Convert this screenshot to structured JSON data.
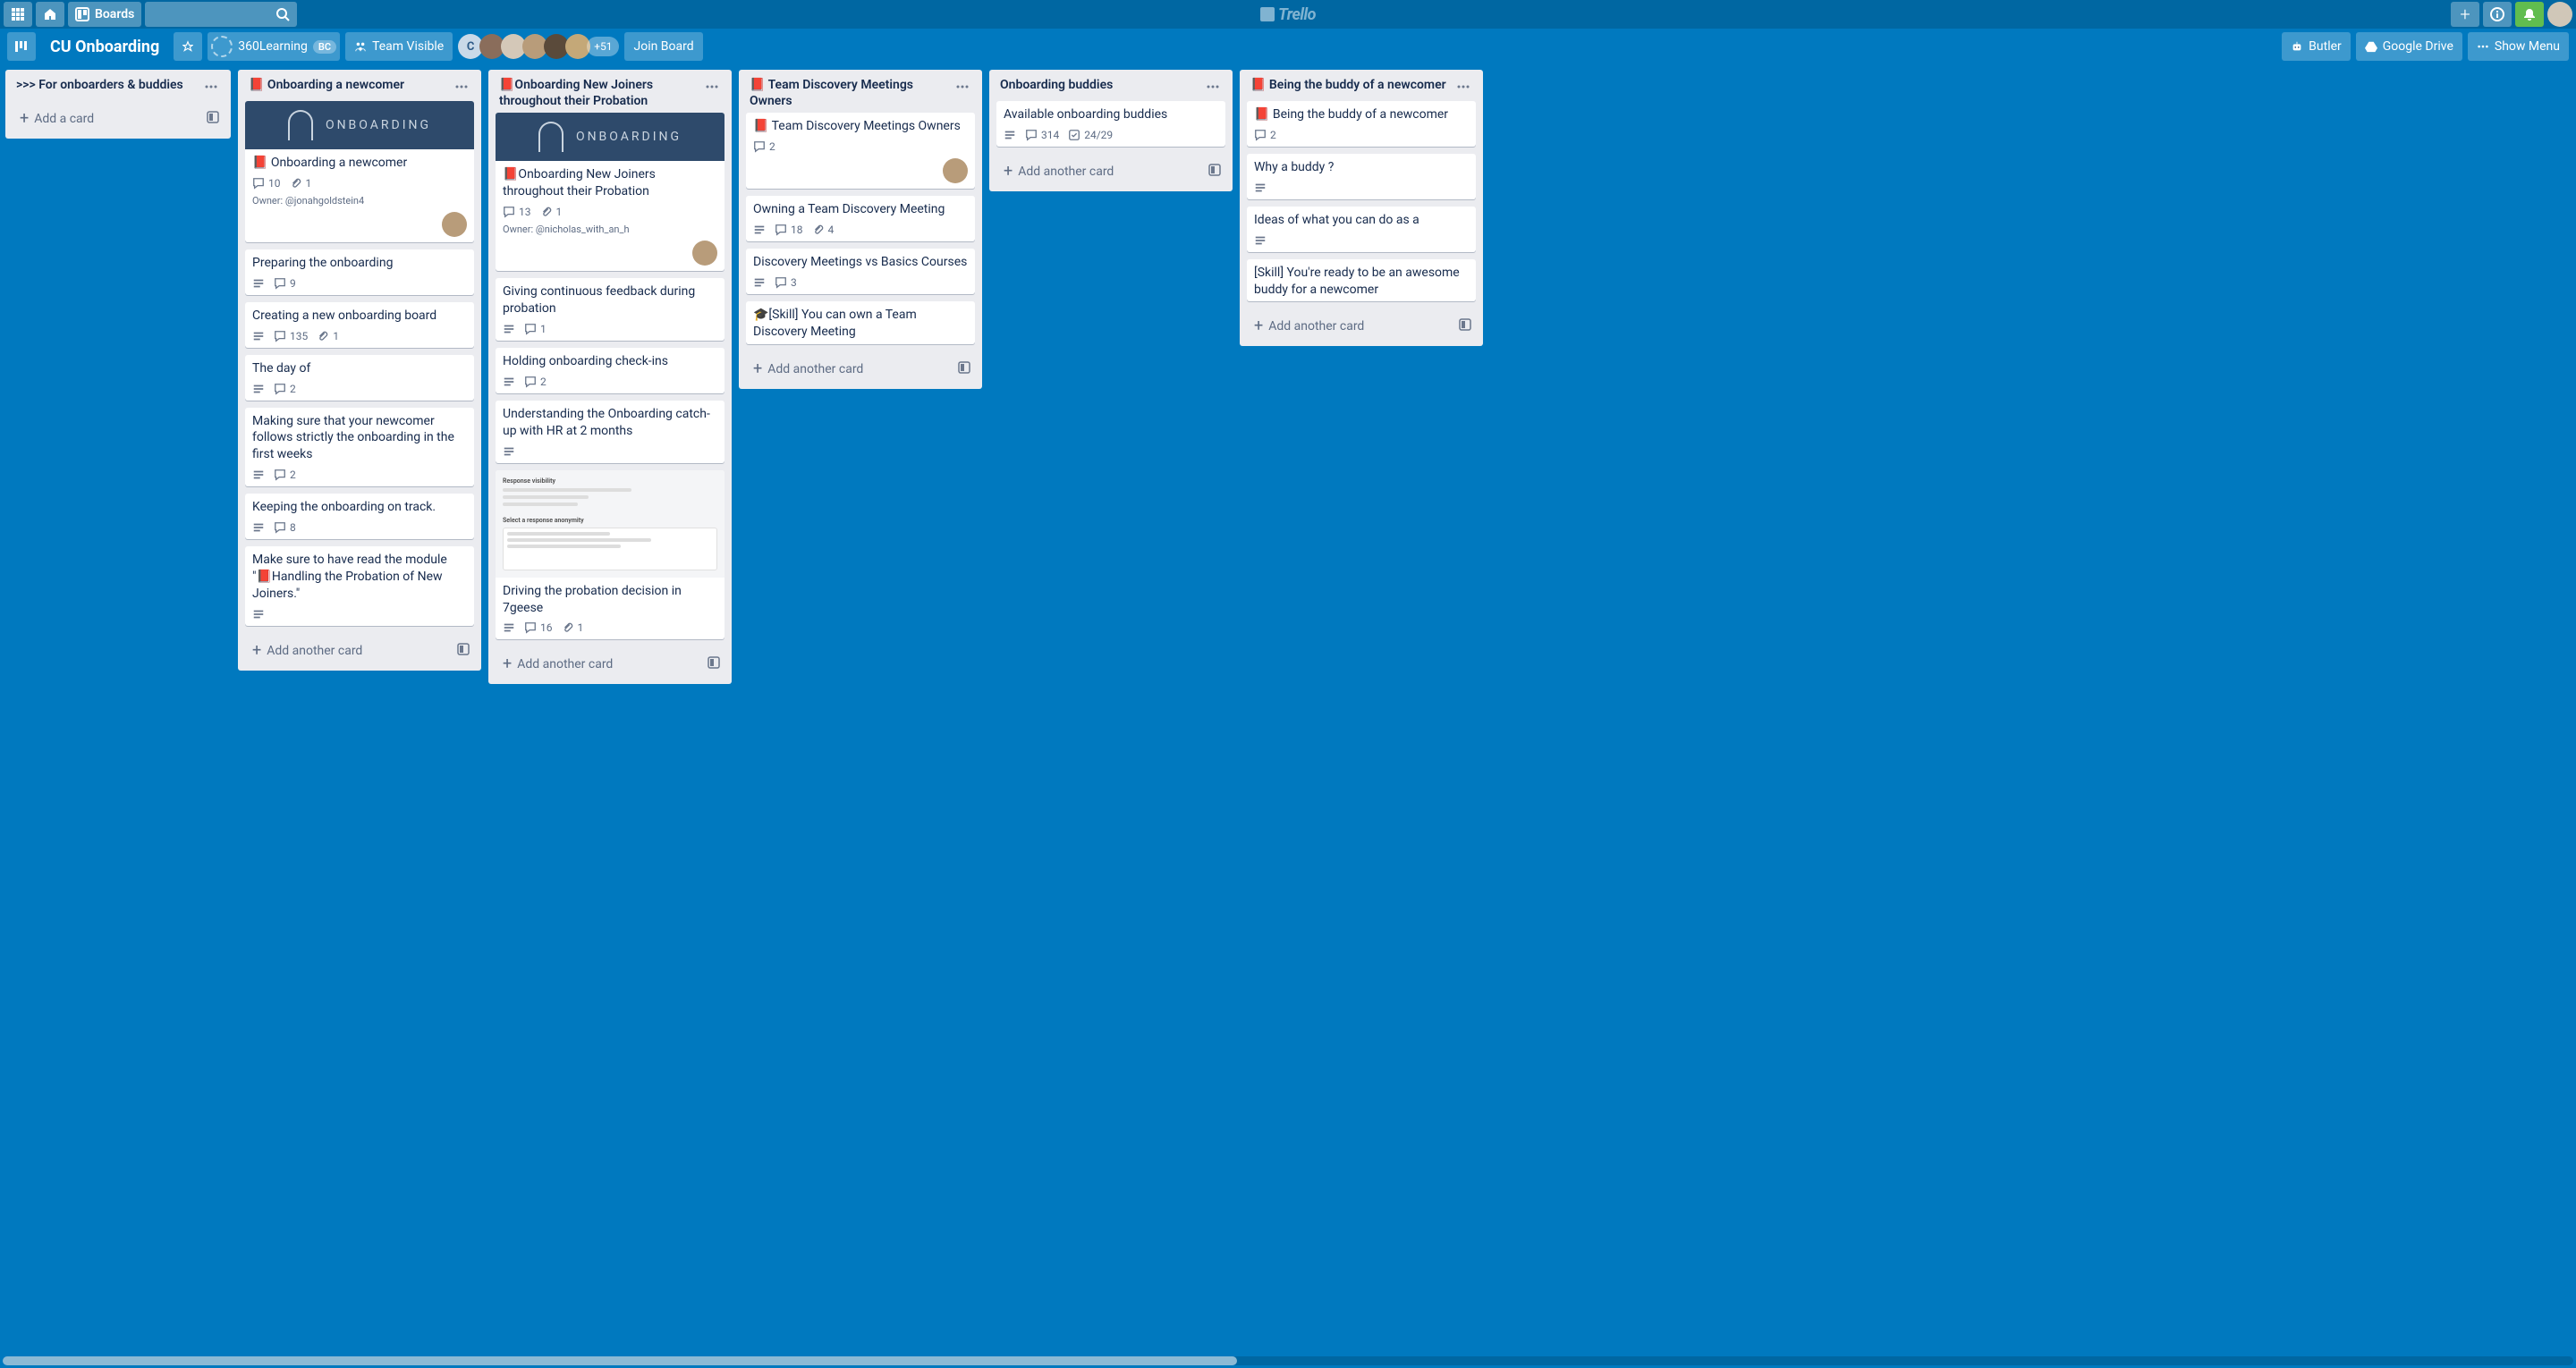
{
  "header": {
    "boards_label": "Boards",
    "logo_text": "Trello"
  },
  "board": {
    "name": "CU Onboarding",
    "org_name": "360Learning",
    "org_badge": "BC",
    "visibility": "Team Visible",
    "member_more": "+51",
    "join_label": "Join Board",
    "butler_label": "Butler",
    "gdrive_label": "Google Drive",
    "show_menu_label": "Show Menu"
  },
  "lists": [
    {
      "title": ">>> For onboarders & buddies",
      "narrow": true,
      "add_label": "Add a card",
      "cards": []
    },
    {
      "title": "📕 Onboarding a newcomer",
      "add_label": "Add another card",
      "cards": [
        {
          "cover": "ONBOARDING",
          "title": "📕 Onboarding a newcomer",
          "comments": "10",
          "attachments": "1",
          "owner": "Owner: @jonahgoldstein4",
          "avatar": true
        },
        {
          "title": "Preparing the onboarding",
          "desc": true,
          "comments": "9"
        },
        {
          "title": "Creating a new onboarding board",
          "desc": true,
          "comments": "135",
          "attachments": "1"
        },
        {
          "title": "The day of",
          "desc": true,
          "comments": "2"
        },
        {
          "title": "Making sure that your newcomer follows strictly the onboarding in the first weeks",
          "desc": true,
          "comments": "2"
        },
        {
          "title": "Keeping the onboarding on track.",
          "desc": true,
          "comments": "8"
        },
        {
          "title": "Make sure to have read the module \"📕Handling the Probation of New Joiners.\"",
          "desc": true
        }
      ]
    },
    {
      "title": "📕Onboarding New Joiners throughout their Probation",
      "add_label": "Add another card",
      "cards": [
        {
          "cover": "ONBOARDING",
          "title": "📕Onboarding New Joiners throughout their Probation",
          "comments": "13",
          "attachments": "1",
          "owner": "Owner: @nicholas_with_an_h",
          "avatar": true
        },
        {
          "title": "Giving continuous feedback during probation",
          "desc": true,
          "comments": "1"
        },
        {
          "title": "Holding onboarding check-ins",
          "desc": true,
          "comments": "2"
        },
        {
          "title": "Understanding the Onboarding catch-up with HR at 2 months",
          "desc": true
        },
        {
          "image_cover": true,
          "title": "Driving the probation decision in 7geese",
          "desc": true,
          "comments": "16",
          "attachments": "1"
        }
      ]
    },
    {
      "title": "📕 Team Discovery Meetings Owners",
      "add_label": "Add another card",
      "cards": [
        {
          "title": "📕 Team Discovery Meetings Owners",
          "comments": "2",
          "avatar": true
        },
        {
          "title": "Owning a Team Discovery Meeting",
          "desc": true,
          "comments": "18",
          "attachments": "4"
        },
        {
          "title": "Discovery Meetings vs Basics Courses",
          "desc": true,
          "comments": "3"
        },
        {
          "title": "🎓[Skill] You can own a Team Discovery Meeting"
        }
      ]
    },
    {
      "title": "Onboarding buddies",
      "add_label": "Add another card",
      "cards": [
        {
          "title": "Available onboarding buddies",
          "desc": true,
          "comments": "314",
          "checklist": "24/29"
        }
      ]
    },
    {
      "title": "📕 Being the buddy of a newcomer",
      "add_label": "Add another card",
      "cutoff": true,
      "cards": [
        {
          "title": "📕 Being the buddy of a newcomer",
          "comments": "2"
        },
        {
          "title": "Why a buddy ?",
          "desc": true
        },
        {
          "title": "Ideas of what you can do as a",
          "desc": true
        },
        {
          "title": "[Skill] You're ready to be an awesome buddy for a newcomer"
        }
      ]
    }
  ]
}
